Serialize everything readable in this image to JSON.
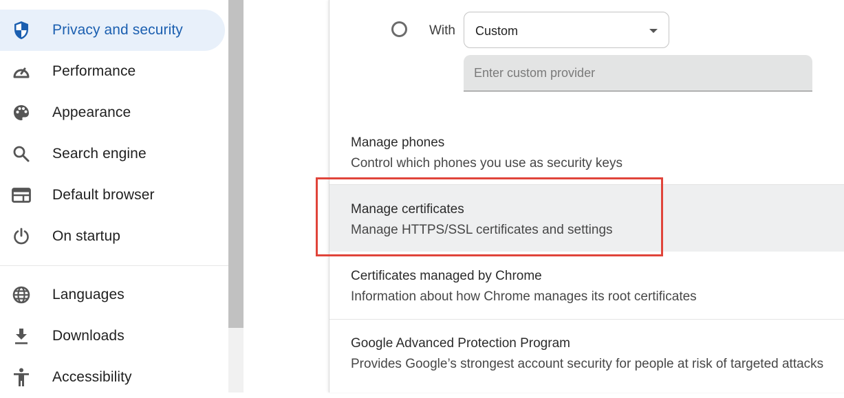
{
  "sidebar": {
    "items": [
      {
        "label": "Privacy and security",
        "icon": "shield-icon",
        "active": true
      },
      {
        "label": "Performance",
        "icon": "speedometer-icon"
      },
      {
        "label": "Appearance",
        "icon": "palette-icon"
      },
      {
        "label": "Search engine",
        "icon": "search-icon"
      },
      {
        "label": "Default browser",
        "icon": "browser-window-icon"
      },
      {
        "label": "On startup",
        "icon": "power-icon"
      },
      {
        "label": "Languages",
        "icon": "globe-icon"
      },
      {
        "label": "Downloads",
        "icon": "download-icon"
      },
      {
        "label": "Accessibility",
        "icon": "accessibility-icon"
      }
    ]
  },
  "secure_dns": {
    "radio_label": "With",
    "provider_select": {
      "value": "Custom"
    },
    "custom_provider_input": {
      "placeholder": "Enter custom provider",
      "value": ""
    }
  },
  "rows": [
    {
      "title": "Manage phones",
      "description": "Control which phones you use as security keys"
    },
    {
      "title": "Manage certificates",
      "description": "Manage HTTPS/SSL certificates and settings",
      "highlighted": true
    },
    {
      "title": "Certificates managed by Chrome",
      "description": "Information about how Chrome manages its root certificates"
    },
    {
      "title": "Google Advanced Protection Program",
      "description": "Provides Google’s strongest account security for people at risk of targeted attacks"
    }
  ],
  "colors": {
    "accent": "#1b5fb0",
    "active_nav_bg": "#e8f0fa",
    "annotation_box": "#e0443a",
    "hover_row_bg": "#eeeff0"
  }
}
